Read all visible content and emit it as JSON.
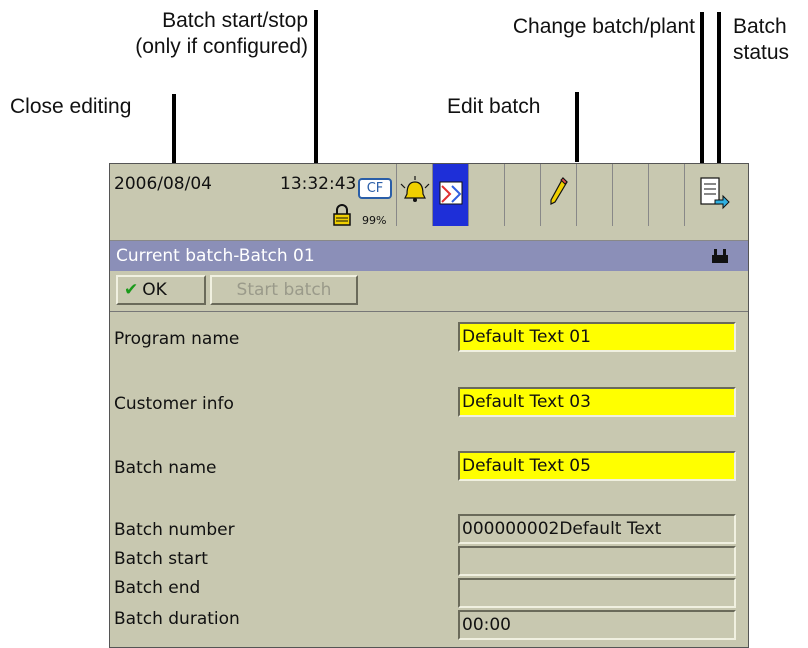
{
  "callouts": {
    "batch_start_stop_line1": "Batch start/stop",
    "batch_start_stop_line2": "(only if configured)",
    "change_batch_plant": "Change batch/plant",
    "batch_status_line1": "Batch",
    "batch_status_line2": "status",
    "close_editing": "Close editing",
    "edit_batch": "Edit batch"
  },
  "topbar": {
    "date": "2006/08/04",
    "time": "13:32:43",
    "cf_label": "CF",
    "cf_percent": "99%"
  },
  "title": "Current batch-Batch 01",
  "buttons": {
    "ok": "OK",
    "start_batch": "Start batch"
  },
  "fields": [
    {
      "label": "Program name",
      "value": "Default Text 01",
      "editable": true
    },
    {
      "label": "Customer info",
      "value": "Default Text 03",
      "editable": true
    },
    {
      "label": "Batch name",
      "value": "Default Text 05",
      "editable": true
    },
    {
      "label": "Batch number",
      "value": "000000002Default Text",
      "editable": false
    },
    {
      "label": "Batch start",
      "value": "",
      "editable": false
    },
    {
      "label": "Batch end",
      "value": "",
      "editable": false
    },
    {
      "label": "Batch duration",
      "value": "00:00",
      "editable": false
    }
  ],
  "colors": {
    "editable_field": "#ffff00",
    "title_bar": "#8b8fb8",
    "active_tab": "#1e2fd8",
    "panel": "#c8c8b0"
  }
}
